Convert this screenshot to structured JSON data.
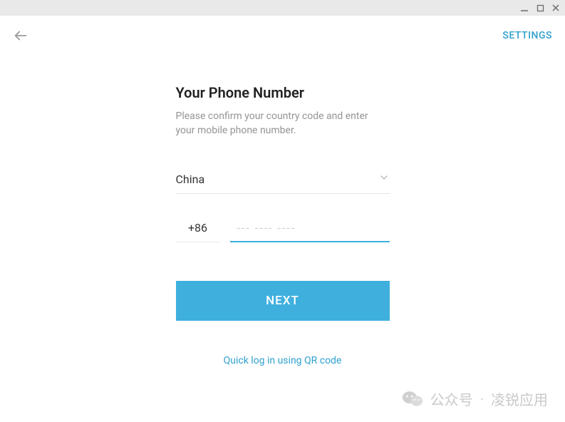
{
  "header": {
    "settings_label": "SETTINGS"
  },
  "form": {
    "title": "Your Phone Number",
    "subtitle": "Please confirm your country code and enter your mobile phone number.",
    "country": "China",
    "country_code": "+86",
    "phone_value": "",
    "phone_placeholder": "--- ---- ----",
    "next_label": "NEXT",
    "qr_link_label": "Quick log in using QR code"
  },
  "watermark": {
    "label1": "公众号",
    "dot": "·",
    "label2": "凌锐应用"
  }
}
